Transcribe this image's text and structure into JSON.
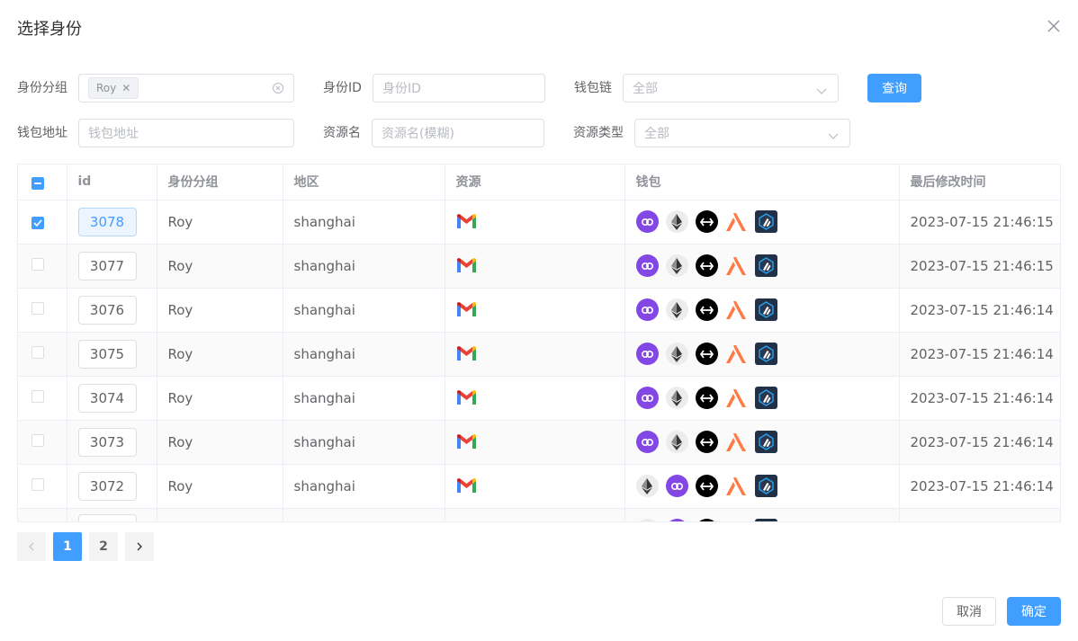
{
  "dialog": {
    "title": "选择身份"
  },
  "filters": {
    "group_label": "身份分组",
    "group_tag": "Roy",
    "id_label": "身份ID",
    "id_placeholder": "身份ID",
    "chain_label": "钱包链",
    "chain_value": "全部",
    "query_button": "查询",
    "address_label": "钱包地址",
    "address_placeholder": "钱包地址",
    "resource_label": "资源名",
    "resource_placeholder": "资源名(模糊)",
    "resource_type_label": "资源类型",
    "resource_type_value": "全部"
  },
  "table": {
    "headers": {
      "id": "id",
      "group": "身份分组",
      "region": "地区",
      "resource": "资源",
      "wallet": "钱包",
      "modified": "最后修改时间"
    },
    "rows": [
      {
        "id": "3078",
        "group": "Roy",
        "region": "shanghai",
        "modified": "2023-07-15 21:46:15",
        "checked": true
      },
      {
        "id": "3077",
        "group": "Roy",
        "region": "shanghai",
        "modified": "2023-07-15 21:46:15",
        "checked": false
      },
      {
        "id": "3076",
        "group": "Roy",
        "region": "shanghai",
        "modified": "2023-07-15 21:46:14",
        "checked": false
      },
      {
        "id": "3075",
        "group": "Roy",
        "region": "shanghai",
        "modified": "2023-07-15 21:46:14",
        "checked": false
      },
      {
        "id": "3074",
        "group": "Roy",
        "region": "shanghai",
        "modified": "2023-07-15 21:46:14",
        "checked": false
      },
      {
        "id": "3073",
        "group": "Roy",
        "region": "shanghai",
        "modified": "2023-07-15 21:46:14",
        "checked": false
      },
      {
        "id": "3072",
        "group": "Roy",
        "region": "shanghai",
        "modified": "2023-07-15 21:46:14",
        "checked": false
      },
      {
        "id": "",
        "group": "",
        "region": "",
        "modified": "",
        "checked": false
      }
    ]
  },
  "pagination": {
    "pages": [
      "1",
      "2"
    ],
    "current": "1"
  },
  "footer": {
    "cancel": "取消",
    "confirm": "确定"
  },
  "colors": {
    "primary": "#409eff",
    "polygon": "#8247e5",
    "arbitrum": "#213147",
    "avalanche": "#ff7a45"
  }
}
